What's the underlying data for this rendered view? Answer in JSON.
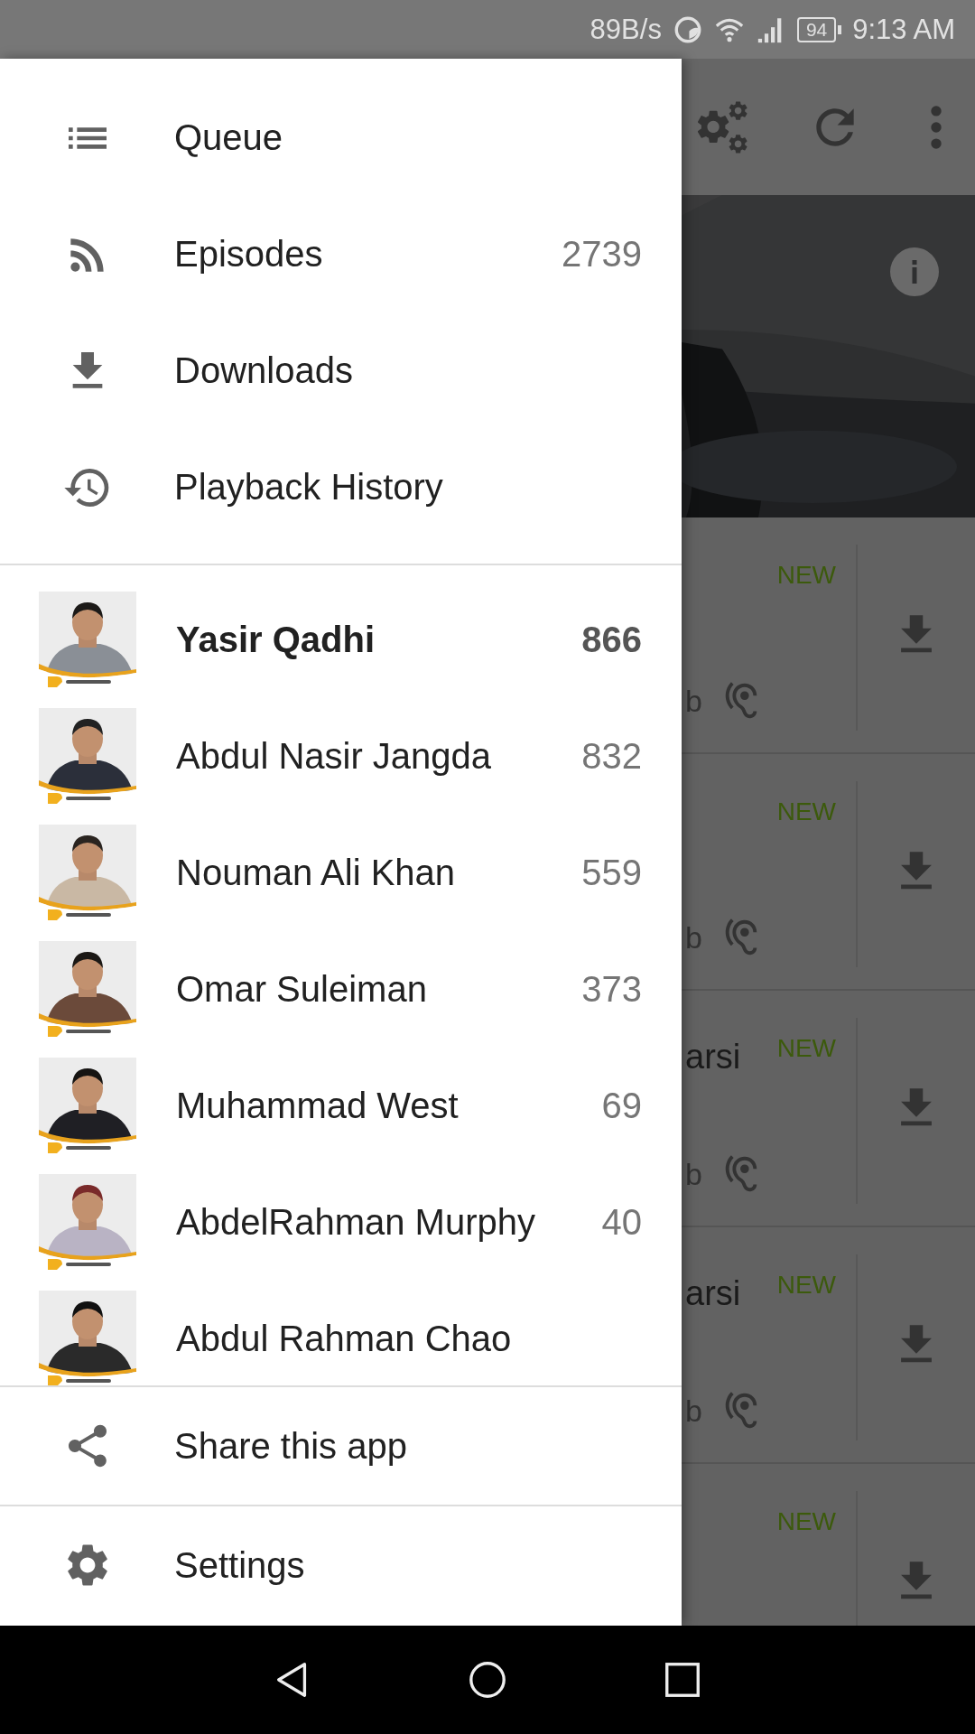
{
  "status_bar": {
    "speed": "89B/s",
    "battery": "94",
    "time": "9:13 AM"
  },
  "background": {
    "episodes": [
      {
        "meta": "b",
        "badge": "NEW"
      },
      {
        "meta": "b",
        "badge": "NEW"
      },
      {
        "title": "arsi",
        "meta": "b",
        "badge": "NEW"
      },
      {
        "title": "arsi",
        "meta": "b",
        "badge": "NEW"
      },
      {
        "badge": "NEW"
      }
    ]
  },
  "drawer": {
    "nav_items": [
      {
        "kind": "queue",
        "label": "Queue"
      },
      {
        "kind": "episodes",
        "label": "Episodes",
        "count": "2739"
      },
      {
        "kind": "downloads",
        "label": "Downloads"
      },
      {
        "kind": "history",
        "label": "Playback History"
      }
    ],
    "subscriptions": [
      {
        "name": "Yasir Qadhi",
        "count": "866",
        "selected": true
      },
      {
        "name": "Abdul Nasir Jangda",
        "count": "832",
        "selected": false
      },
      {
        "name": "Nouman Ali Khan",
        "count": "559",
        "selected": false
      },
      {
        "name": "Omar Suleiman",
        "count": "373",
        "selected": false
      },
      {
        "name": "Muhammad West",
        "count": "69",
        "selected": false
      },
      {
        "name": "AbdelRahman Murphy",
        "count": "40",
        "selected": false
      },
      {
        "name": "Abdul Rahman Chao",
        "selected": false
      }
    ],
    "footer_items": [
      {
        "kind": "share",
        "label": "Share this app"
      },
      {
        "kind": "settings",
        "label": "Settings"
      }
    ]
  }
}
